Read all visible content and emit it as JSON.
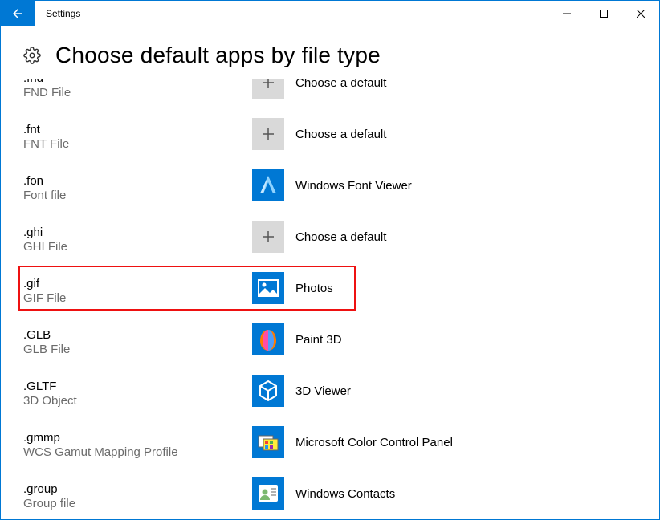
{
  "window": {
    "title": "Settings"
  },
  "page": {
    "heading": "Choose default apps by file type"
  },
  "rows": [
    {
      "ext": ".fnd",
      "desc": "FND File",
      "icon": "plus",
      "app": "Choose a default"
    },
    {
      "ext": ".fnt",
      "desc": "FNT File",
      "icon": "plus",
      "app": "Choose a default"
    },
    {
      "ext": ".fon",
      "desc": "Font file",
      "icon": "font-viewer",
      "app": "Windows Font Viewer"
    },
    {
      "ext": ".ghi",
      "desc": "GHI File",
      "icon": "plus",
      "app": "Choose a default"
    },
    {
      "ext": ".gif",
      "desc": "GIF File",
      "icon": "photos",
      "app": "Photos",
      "highlighted": true
    },
    {
      "ext": ".GLB",
      "desc": "GLB File",
      "icon": "paint3d",
      "app": "Paint 3D"
    },
    {
      "ext": ".GLTF",
      "desc": "3D Object",
      "icon": "3dviewer",
      "app": "3D Viewer"
    },
    {
      "ext": ".gmmp",
      "desc": "WCS Gamut Mapping Profile",
      "icon": "colorpanel",
      "app": "Microsoft Color Control Panel"
    },
    {
      "ext": ".group",
      "desc": "Group file",
      "icon": "contacts",
      "app": "Windows Contacts"
    }
  ]
}
